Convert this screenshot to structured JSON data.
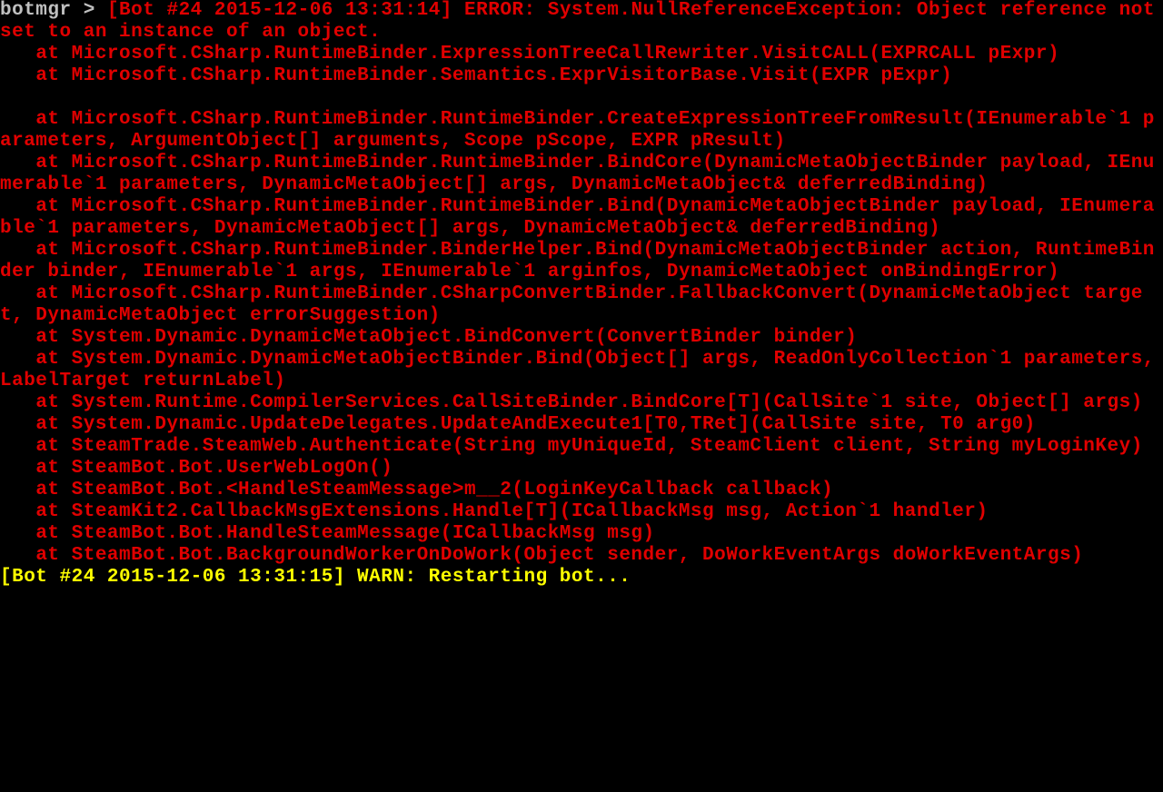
{
  "prompt": {
    "label": "botmgr",
    "arrow": ">"
  },
  "error": {
    "header": "[Bot #24 2015-12-06 13:31:14] ERROR: System.NullReferenceException: Object reference not set to an instance of an object.",
    "stack": [
      "   at Microsoft.CSharp.RuntimeBinder.ExpressionTreeCallRewriter.VisitCALL(EXPRCALL pExpr)",
      "   at Microsoft.CSharp.RuntimeBinder.Semantics.ExprVisitorBase.Visit(EXPR pExpr)",
      "",
      "   at Microsoft.CSharp.RuntimeBinder.RuntimeBinder.CreateExpressionTreeFromResult(IEnumerable`1 parameters, ArgumentObject[] arguments, Scope pScope, EXPR pResult)",
      "   at Microsoft.CSharp.RuntimeBinder.RuntimeBinder.BindCore(DynamicMetaObjectBinder payload, IEnumerable`1 parameters, DynamicMetaObject[] args, DynamicMetaObject& deferredBinding)",
      "   at Microsoft.CSharp.RuntimeBinder.RuntimeBinder.Bind(DynamicMetaObjectBinder payload, IEnumerable`1 parameters, DynamicMetaObject[] args, DynamicMetaObject& deferredBinding)",
      "   at Microsoft.CSharp.RuntimeBinder.BinderHelper.Bind(DynamicMetaObjectBinder action, RuntimeBinder binder, IEnumerable`1 args, IEnumerable`1 arginfos, DynamicMetaObject onBindingError)",
      "   at Microsoft.CSharp.RuntimeBinder.CSharpConvertBinder.FallbackConvert(DynamicMetaObject target, DynamicMetaObject errorSuggestion)",
      "   at System.Dynamic.DynamicMetaObject.BindConvert(ConvertBinder binder)",
      "   at System.Dynamic.DynamicMetaObjectBinder.Bind(Object[] args, ReadOnlyCollection`1 parameters, LabelTarget returnLabel)",
      "   at System.Runtime.CompilerServices.CallSiteBinder.BindCore[T](CallSite`1 site, Object[] args)",
      "   at System.Dynamic.UpdateDelegates.UpdateAndExecute1[T0,TRet](CallSite site, T0 arg0)",
      "   at SteamTrade.SteamWeb.Authenticate(String myUniqueId, SteamClient client, String myLoginKey)",
      "   at SteamBot.Bot.UserWebLogOn()",
      "   at SteamBot.Bot.<HandleSteamMessage>m__2(LoginKeyCallback callback)",
      "   at SteamKit2.CallbackMsgExtensions.Handle[T](ICallbackMsg msg, Action`1 handler)",
      "   at SteamBot.Bot.HandleSteamMessage(ICallbackMsg msg)",
      "   at SteamBot.Bot.BackgroundWorkerOnDoWork(Object sender, DoWorkEventArgs doWorkEventArgs)"
    ]
  },
  "warn": {
    "line": "[Bot #24 2015-12-06 13:31:15] WARN: Restarting bot..."
  }
}
